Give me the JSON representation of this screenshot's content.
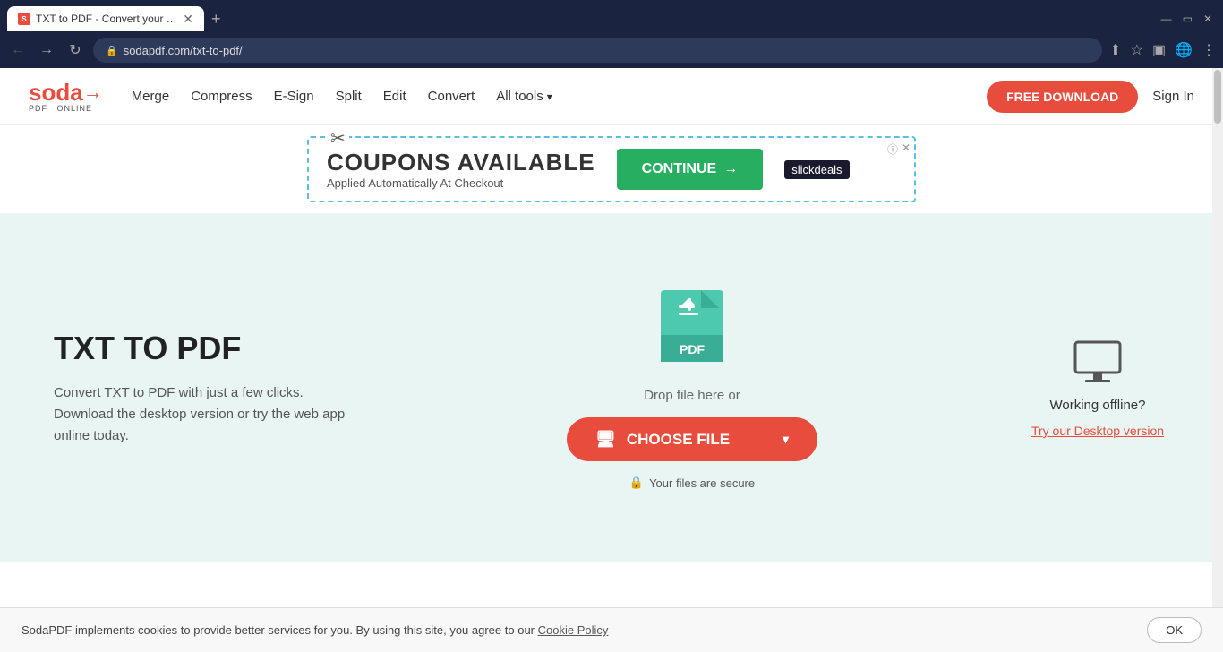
{
  "browser": {
    "tab_title": "TXT to PDF - Convert your TXT t...",
    "tab_favicon": "S",
    "url": "sodapdf.com/txt-to-pdf/",
    "new_tab_label": "+",
    "back_icon": "←",
    "forward_icon": "→",
    "refresh_icon": "↻"
  },
  "header": {
    "logo_text": "soda",
    "logo_sub1": "PDF",
    "logo_sub2": "ONLINE",
    "nav": {
      "merge": "Merge",
      "compress": "Compress",
      "esign": "E-Sign",
      "split": "Split",
      "edit": "Edit",
      "convert": "Convert",
      "all_tools": "All tools"
    },
    "free_download": "FREE DOWNLOAD",
    "sign_in": "Sign In"
  },
  "ad": {
    "title": "COUPONS AVAILABLE",
    "subtitle": "Applied Automatically At Checkout",
    "continue_btn": "CONTINUE",
    "brand": "slickdeals"
  },
  "main": {
    "page_title": "TXT TO PDF",
    "page_desc": "Convert TXT to PDF with just a few clicks. Download the desktop version or try the web app online today.",
    "drop_text": "Drop file here or",
    "choose_file_btn": "CHOOSE FILE",
    "secure_text": "Your files are secure",
    "offline_title": "Working offline?",
    "desktop_link": "Try our Desktop version"
  },
  "cookie": {
    "text": "SodaPDF implements cookies to provide better services for you. By using this site, you agree to our",
    "link_text": "Cookie Policy",
    "ok_btn": "OK"
  }
}
